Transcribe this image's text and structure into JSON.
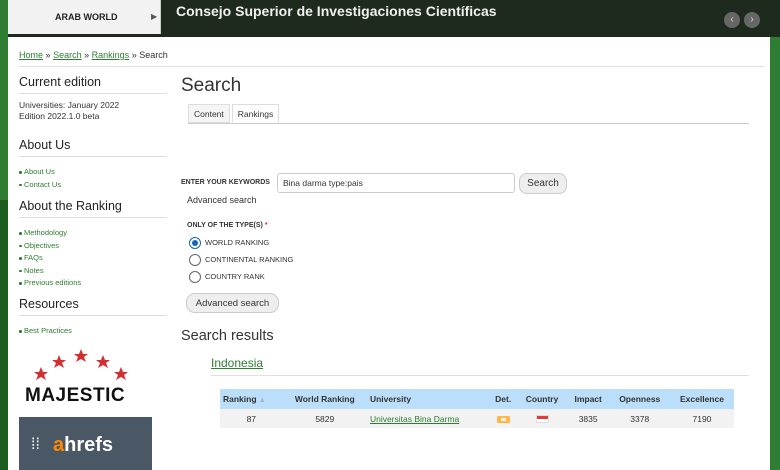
{
  "header": {
    "nav_tab_label": "ARAB WORLD",
    "site_title": "Consejo Superior de Investigaciones Científicas"
  },
  "breadcrumb": {
    "home": "Home",
    "sep": "»",
    "search": "Search",
    "rankings": "Rankings",
    "current": "Search"
  },
  "sidebar": {
    "current_edition": {
      "title": "Current edition",
      "line1": "Universities: January 2022",
      "line2": "Edition 2022.1.0 beta"
    },
    "about_us": {
      "title": "About Us",
      "items": [
        "About Us",
        "Contact Us"
      ]
    },
    "about_ranking": {
      "title": "About the Ranking",
      "items": [
        "Methodology",
        "Objectives",
        "FAQs",
        "Notes",
        "Previous editions"
      ]
    },
    "resources": {
      "title": "Resources",
      "items": [
        "Best Practices"
      ]
    },
    "logos": {
      "majestic": "MAJESTIC",
      "ahrefs_a": "a",
      "ahrefs_rest": "hrefs"
    }
  },
  "main": {
    "page_title": "Search",
    "tabs": [
      {
        "label": "Content"
      },
      {
        "label": "Rankings"
      }
    ],
    "keywords_label": "ENTER YOUR KEYWORDS",
    "keywords_value": "Bina darma type:pais",
    "search_button": "Search",
    "advanced_link": "Advanced search",
    "type_label": "ONLY OF THE TYPE(S)",
    "type_required": "*",
    "types": [
      {
        "label": "WORLD RANKING",
        "checked": true
      },
      {
        "label": "CONTINENTAL RANKING",
        "checked": false
      },
      {
        "label": "COUNTRY RANK",
        "checked": false
      }
    ],
    "advanced_button": "Advanced search",
    "results_title": "Search results",
    "country": "Indonesia",
    "table": {
      "headers": [
        "Ranking",
        "World Ranking",
        "University",
        "Det.",
        "Country",
        "Impact",
        "Openness",
        "Excellence"
      ],
      "rows": [
        {
          "ranking": "87",
          "world_ranking": "5829",
          "university": "Universitas Bina Darma",
          "impact": "3835",
          "openness": "3378",
          "excellence": "7190"
        }
      ]
    }
  },
  "colors": {
    "brand_green": "#2e7d32",
    "table_header": "#bbdefb"
  }
}
